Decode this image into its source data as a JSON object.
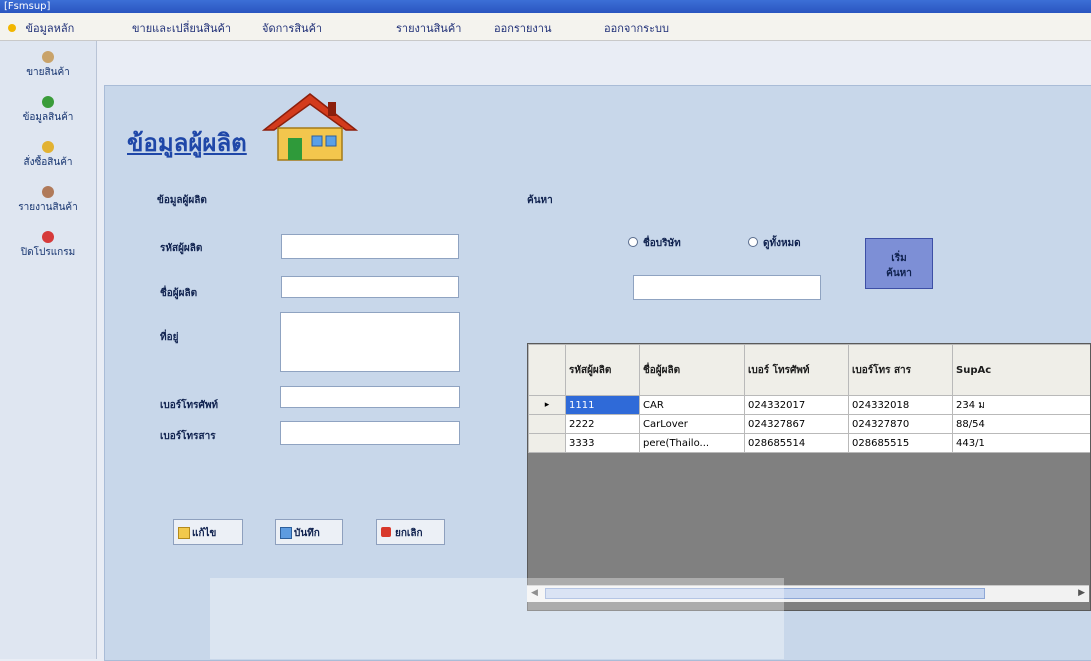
{
  "window": {
    "title": "[Fsmsup]"
  },
  "menu": [
    "ข้อมูลหลัก",
    "ขายและเปลี่ยนสินค้า",
    "จัดการสินค้า",
    "รายงานสินค้า",
    "ออกรายงาน",
    "ออกจากระบบ"
  ],
  "sidebar": [
    {
      "label": "ขายสินค้า",
      "icon": "cart-icon",
      "color": "#c9a36a"
    },
    {
      "label": "ข้อมูลสินค้า",
      "icon": "box-icon",
      "color": "#3a9c3a"
    },
    {
      "label": "สั่งซื้อสินค้า",
      "icon": "order-icon",
      "color": "#e2b233"
    },
    {
      "label": "รายงานสินค้า",
      "icon": "report-icon",
      "color": "#b07a5a"
    },
    {
      "label": "ปิดโปรแกรม",
      "icon": "close-icon",
      "color": "#d63a3a"
    }
  ],
  "page": {
    "heading": "ข้อมูลผู้ผลิต"
  },
  "form": {
    "group_label": "ข้อมูลผู้ผลิต",
    "fields": {
      "id_label": "รหัสผู้ผลิต",
      "id_value": "",
      "name_label": "ชื่อผู้ผลิต",
      "name_value": "",
      "address_label": "ที่อยู่",
      "address_value": "",
      "phone_label": "เบอร์โทรศัพท์",
      "phone_value": "",
      "fax_label": "เบอร์โทรสาร",
      "fax_value": ""
    },
    "buttons": {
      "edit": "แก้ไข",
      "save": "บันทึก",
      "cancel": "ยกเลิก"
    }
  },
  "search": {
    "group_label": "ค้นหา",
    "radio_company": "ชื่อบริษัท",
    "radio_all": "ดูทั้งหมด",
    "input_value": "",
    "button_line1": "เริ่ม",
    "button_line2": "ค้นหา"
  },
  "grid": {
    "columns": [
      "รหัสผู้ผลิต",
      "ชื่อผู้ผลิต",
      "เบอร์ โทรศัพท์",
      "เบอร์โทร สาร",
      "SupAc"
    ],
    "rows": [
      {
        "marker": "▸",
        "id": "1111",
        "name": "CAR",
        "phone": "024332017",
        "fax": "024332018",
        "addr": "234 ม"
      },
      {
        "marker": "",
        "id": "2222",
        "name": "CarLover",
        "phone": "024327867",
        "fax": "024327870",
        "addr": "88/54"
      },
      {
        "marker": "",
        "id": "3333",
        "name": "pere(Thailo...",
        "phone": "028685514",
        "fax": "028685515",
        "addr": "443/1"
      }
    ]
  }
}
